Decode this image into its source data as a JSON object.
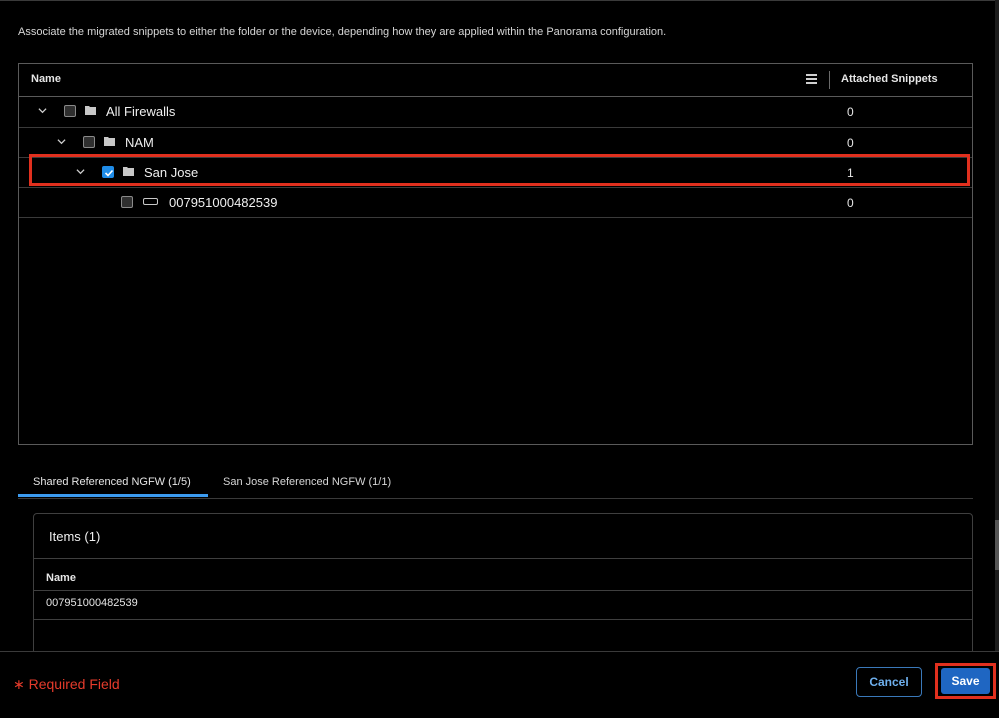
{
  "description": "Associate the migrated snippets to either the folder or the device, depending how they are applied within the Panorama configuration.",
  "tree": {
    "columns": {
      "name": "Name",
      "snippets": "Attached Snippets"
    },
    "rows": [
      {
        "label": "All Firewalls",
        "count": "0",
        "type": "folder",
        "checked": false
      },
      {
        "label": "NAM",
        "count": "0",
        "type": "folder",
        "checked": false
      },
      {
        "label": "San Jose",
        "count": "1",
        "type": "folder",
        "checked": true
      },
      {
        "label": "007951000482539",
        "count": "0",
        "type": "device",
        "checked": false
      }
    ]
  },
  "tabs": [
    {
      "label": "Shared Referenced NGFW (1/5)",
      "active": true
    },
    {
      "label": "San Jose Referenced NGFW (1/1)",
      "active": false
    }
  ],
  "items": {
    "title": "Items (1)",
    "column": "Name",
    "rows": [
      "007951000482539"
    ]
  },
  "footer": {
    "required": "Required Field",
    "cancel": "Cancel",
    "save": "Save"
  },
  "colors": {
    "accent": "#1f8ce8",
    "highlight": "#e1301e",
    "required": "#e53b2b"
  }
}
